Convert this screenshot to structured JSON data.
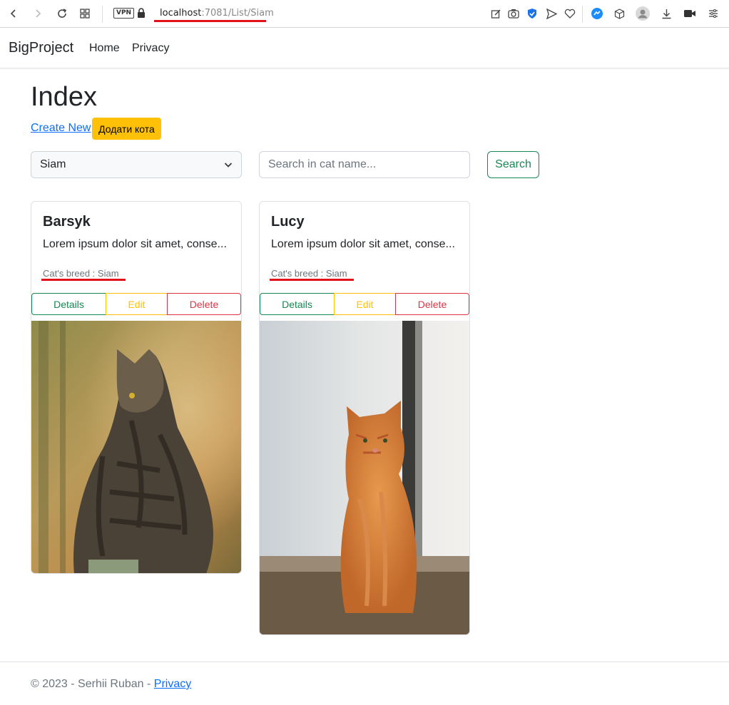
{
  "browser": {
    "url_host": "localhost",
    "url_rest": ":7081/List/Siam",
    "vpn_label": "VPN",
    "accent": "#e3111a"
  },
  "navbar": {
    "brand": "BigProject",
    "links": [
      "Home",
      "Privacy"
    ]
  },
  "main": {
    "title": "Index",
    "create_link": "Create New",
    "add_cat_button": "Додати кота",
    "breed_select": {
      "selected": "Siam"
    },
    "search": {
      "placeholder": "Search in cat name...",
      "value": "",
      "button": "Search"
    }
  },
  "cards": [
    {
      "name": "Barsyk",
      "description": "Lorem ipsum dolor sit amet, conse...",
      "breed": "Cat's breed : Siam",
      "buttons": [
        "Details",
        "Edit",
        "Delete"
      ],
      "image": "tabby-cat-photo"
    },
    {
      "name": "Lucy",
      "description": "Lorem ipsum dolor sit amet, conse...",
      "breed": "Cat's breed : Siam",
      "buttons": [
        "Details",
        "Edit",
        "Delete"
      ],
      "image": "orange-cat-photo"
    }
  ],
  "footer": {
    "copyright": "© 2023 - Serhii Ruban - ",
    "privacy_link": "Privacy"
  },
  "colors": {
    "primary": "#0d6efd",
    "success": "#198754",
    "warning": "#ffc107",
    "danger": "#dc3545"
  }
}
